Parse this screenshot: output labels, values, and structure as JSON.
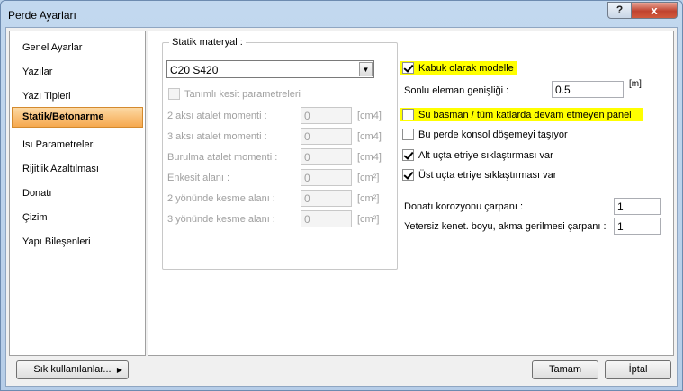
{
  "window": {
    "title": "Perde Ayarları",
    "help_label": "?",
    "close_label": "x"
  },
  "sidebar": {
    "items": [
      {
        "label": "Genel Ayarlar"
      },
      {
        "label": "Yazılar"
      },
      {
        "label": "Yazı Tipleri"
      },
      {
        "label": "Statik/Betonarme"
      },
      {
        "label": "Isı Parametreleri"
      },
      {
        "label": "Rijitlik Azaltılması"
      },
      {
        "label": "Donatı"
      },
      {
        "label": "Çizim"
      },
      {
        "label": "Yapı Bileşenleri"
      }
    ],
    "active_index": 3
  },
  "material_group": {
    "title": "Statik materyal :",
    "combo_value": "C20 S420",
    "tanimli_label": "Tanımlı kesit parametreleri",
    "rows": [
      {
        "label": "2 aksı atalet momenti :",
        "value": "0",
        "unit": "[cm4]"
      },
      {
        "label": "3 aksı atalet momenti :",
        "value": "0",
        "unit": "[cm4]"
      },
      {
        "label": "Burulma atalet momenti :",
        "value": "0",
        "unit": "[cm4]"
      },
      {
        "label": "Enkesit alanı :",
        "value": "0",
        "unit": "[cm²]"
      },
      {
        "label": "2 yönünde kesme alanı :",
        "value": "0",
        "unit": "[cm²]"
      },
      {
        "label": "3 yönünde kesme alanı :",
        "value": "0",
        "unit": "[cm²]"
      }
    ]
  },
  "options": {
    "kabuk": {
      "label": "Kabuk olarak modelle",
      "checked": true
    },
    "sonlu_label": "Sonlu eleman genişliği :",
    "sonlu_value": "0.5",
    "sonlu_unit": "[m]",
    "su_basman": {
      "label": "Su basman / tüm katlarda devam etmeyen panel",
      "checked": false
    },
    "konsol": {
      "label": "Bu perde konsol döşemeyi taşıyor",
      "checked": false
    },
    "alt_uc": {
      "label": "Alt uçta etriye sıklaştırması var",
      "checked": true
    },
    "ust_uc": {
      "label": "Üst uçta etriye sıklaştırması var",
      "checked": true
    },
    "korozyon_label": "Donatı korozyonu çarpanı :",
    "korozyon_value": "1",
    "yetersiz_label": "Yetersiz kenet. boyu, akma gerilmesi çarpanı :",
    "yetersiz_value": "1"
  },
  "buttons": {
    "sik": "Sık kullanılanlar...",
    "tamam": "Tamam",
    "iptal": "İptal"
  },
  "colors": {
    "highlight": "#ffff00",
    "active_item": "#f6a84e"
  }
}
